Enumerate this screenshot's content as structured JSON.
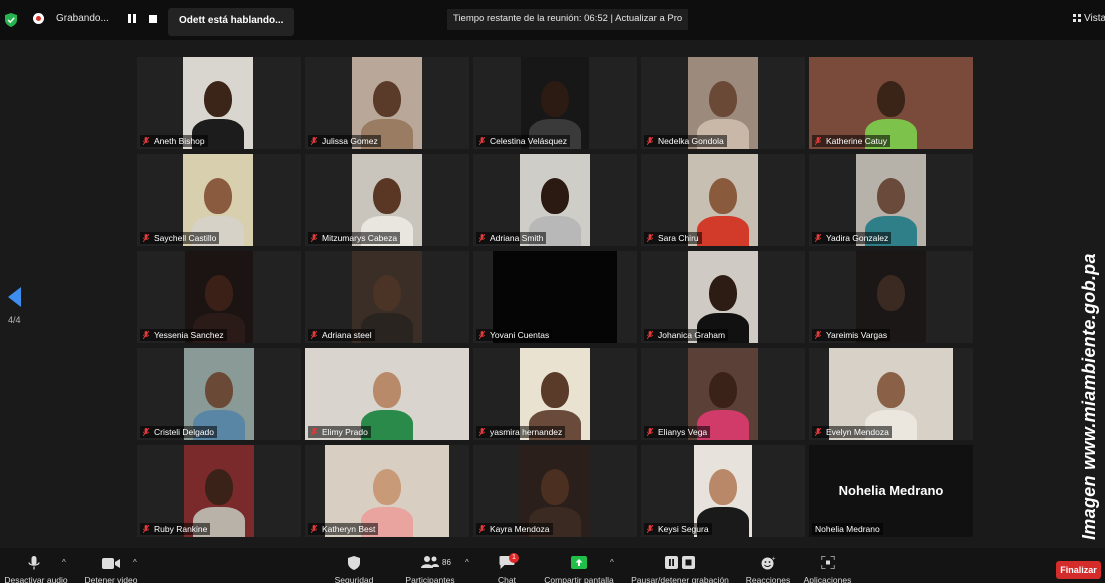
{
  "colors": {
    "accent": "#3d8ef0",
    "share": "#1fbf4a",
    "end": "#d42b2b",
    "muted_mic": "#e03a3a",
    "security": "#27b34f"
  },
  "topbar": {
    "recording_label": "Grabando...",
    "speaking_label": "Odett está hablando...",
    "timer_label": "Tiempo restante de la reunión: 06:52 | Actualizar a Pro",
    "view_label": "Vista",
    "icons": [
      "shield-check-icon",
      "record-icon",
      "pause-icon",
      "stop-icon",
      "grid-view-icon"
    ]
  },
  "pagination": {
    "label": "4/4"
  },
  "participants": [
    {
      "name": "Aneth Bishop"
    },
    {
      "name": "Julissa Gomez"
    },
    {
      "name": "Celestina Velásquez"
    },
    {
      "name": "Nedelka Gondola"
    },
    {
      "name": "Katherine Catuy"
    },
    {
      "name": "Saychell Castillo"
    },
    {
      "name": "Mitzumarys Cabeza"
    },
    {
      "name": "Adriana Smith"
    },
    {
      "name": "Sara Chiru"
    },
    {
      "name": "Yadira Gonzalez"
    },
    {
      "name": "Yessenia Sanchez"
    },
    {
      "name": "Adriana steel"
    },
    {
      "name": "Yovani Cuentas"
    },
    {
      "name": "Johanica Graham"
    },
    {
      "name": "Yareimis Vargas"
    },
    {
      "name": "Cristeli Delgado"
    },
    {
      "name": "Elimy Prado"
    },
    {
      "name": "yasmira hernandez"
    },
    {
      "name": "Elianys Vega"
    },
    {
      "name": "Evelyn Mendoza"
    },
    {
      "name": "Ruby Rankine"
    },
    {
      "name": "Katheryn Best"
    },
    {
      "name": "Kayra Mendoza"
    },
    {
      "name": "Keysi Segura"
    },
    {
      "name": "Nohelia Medrano"
    }
  ],
  "watermark": "Imagen www.miambiente.gob.pa",
  "toolbar": {
    "mute": "Desactivar audio",
    "video": "Detener video",
    "security": "Seguridad",
    "participants": "Participantes",
    "participants_count": "86",
    "chat": "Chat",
    "chat_badge": "1",
    "share": "Compartir pantalla",
    "record": "Pausar/detener grabación",
    "reactions": "Reacciones",
    "apps": "Aplicaciones",
    "caret": "^",
    "end": "Finalizar"
  }
}
